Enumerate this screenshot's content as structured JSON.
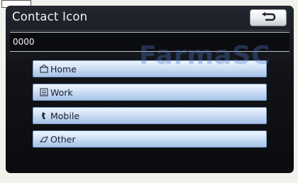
{
  "header": {
    "title": "Contact Icon",
    "back_icon": "return-arrow-icon"
  },
  "name_field": {
    "value": "0000"
  },
  "icon_options": [
    {
      "label": "Home",
      "icon": "home-icon"
    },
    {
      "label": "Work",
      "icon": "work-icon"
    },
    {
      "label": "Mobile",
      "icon": "mobile-icon"
    },
    {
      "label": "Other",
      "icon": "other-icon"
    }
  ],
  "watermark": "FarmaSC",
  "colors": {
    "button_face": "#cfe0f6",
    "screen_bg": "#0a0b0e",
    "title_text": "#f2f2f2"
  }
}
